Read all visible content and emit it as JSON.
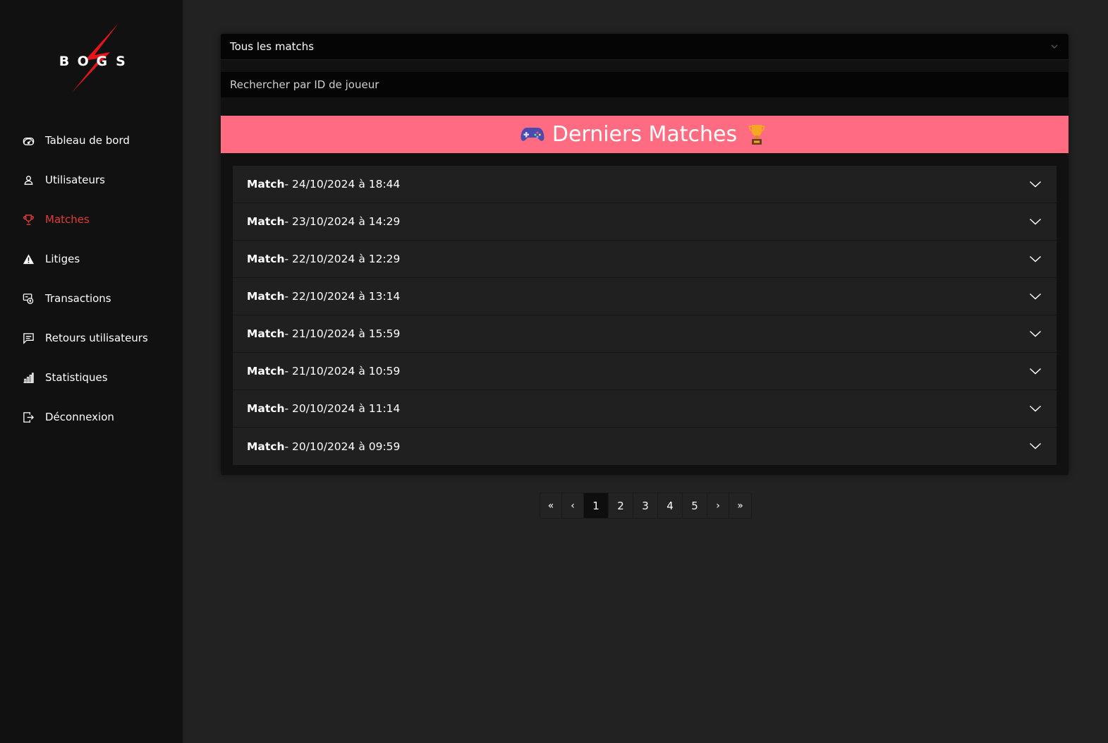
{
  "brand": {
    "letters": [
      "B",
      "O",
      "G",
      "S"
    ],
    "bolt_color": "#e8141b"
  },
  "sidebar": {
    "items": [
      {
        "label": "Tableau de bord",
        "icon": "dashboard-gauge-icon",
        "active": false
      },
      {
        "label": "Utilisateurs",
        "icon": "user-icon",
        "active": false
      },
      {
        "label": "Matches",
        "icon": "trophy-icon",
        "active": true
      },
      {
        "label": "Litiges",
        "icon": "warning-icon",
        "active": false
      },
      {
        "label": "Transactions",
        "icon": "transactions-icon",
        "active": false
      },
      {
        "label": "Retours utilisateurs",
        "icon": "feedback-icon",
        "active": false
      },
      {
        "label": "Statistiques",
        "icon": "bar-chart-icon",
        "active": false
      },
      {
        "label": "Déconnexion",
        "icon": "logout-icon",
        "active": false
      }
    ],
    "active_color": "#e53935"
  },
  "filter": {
    "selected": "Tous les matchs"
  },
  "search": {
    "placeholder": "Rechercher par ID de joueur"
  },
  "banner": {
    "title": "Derniers Matches",
    "left_icon": "gamepad-icon",
    "right_icon": "trophy-icon",
    "color": "#ff6b81"
  },
  "matches": [
    {
      "prefix": "Match",
      "date": "- 24/10/2024 à 18:44"
    },
    {
      "prefix": "Match",
      "date": "- 23/10/2024 à 14:29"
    },
    {
      "prefix": "Match",
      "date": "- 22/10/2024 à 12:29"
    },
    {
      "prefix": "Match",
      "date": "- 22/10/2024 à 13:14"
    },
    {
      "prefix": "Match",
      "date": "- 21/10/2024 à 15:59"
    },
    {
      "prefix": "Match",
      "date": "- 21/10/2024 à 10:59"
    },
    {
      "prefix": "Match",
      "date": "- 20/10/2024 à 11:14"
    },
    {
      "prefix": "Match",
      "date": "- 20/10/2024 à 09:59"
    }
  ],
  "pagination": {
    "first": "«",
    "prev": "‹",
    "pages": [
      "1",
      "2",
      "3",
      "4",
      "5"
    ],
    "current": "1",
    "next": "›",
    "last": "»"
  }
}
